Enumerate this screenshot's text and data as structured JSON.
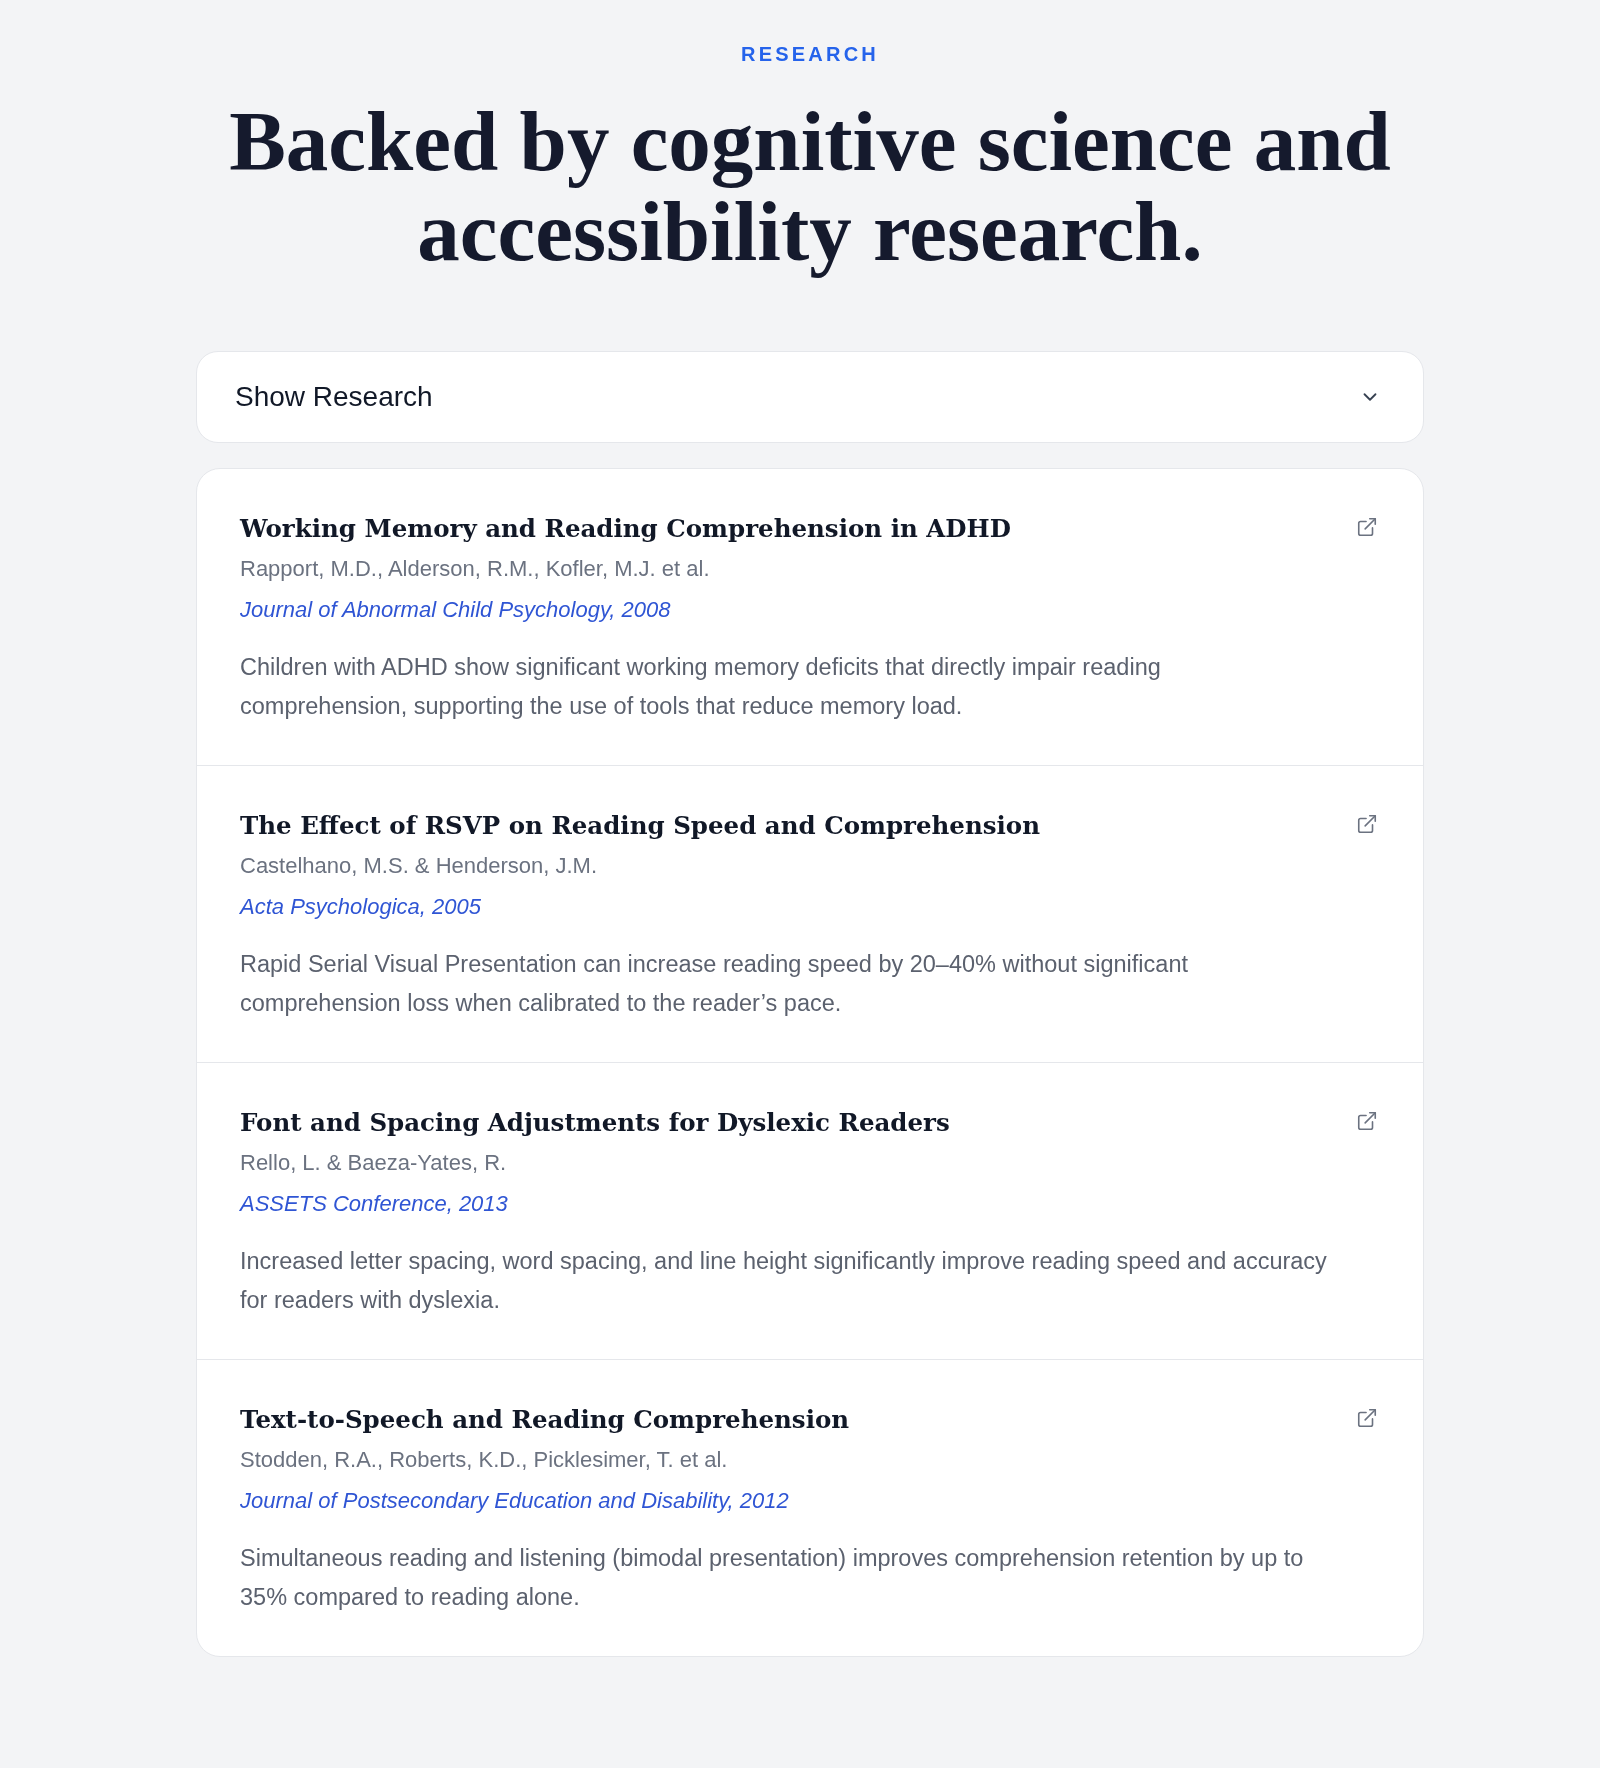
{
  "eyebrow": "RESEARCH",
  "headline": "Backed by cognitive science and accessibility research.",
  "toggle": {
    "label": "Show Research"
  },
  "studies": [
    {
      "title": "Working Memory and Reading Comprehension in ADHD",
      "authors": "Rapport, M.D., Alderson, R.M., Kofler, M.J. et al.",
      "source": "Journal of Abnormal Child Psychology, 2008",
      "summary": "Children with ADHD show significant working memory deficits that directly impair reading comprehension, supporting the use of tools that reduce memory load."
    },
    {
      "title": "The Effect of RSVP on Reading Speed and Comprehension",
      "authors": "Castelhano, M.S. & Henderson, J.M.",
      "source": "Acta Psychologica, 2005",
      "summary": "Rapid Serial Visual Presentation can increase reading speed by 20–40% without significant comprehension loss when calibrated to the reader’s pace."
    },
    {
      "title": "Font and Spacing Adjustments for Dyslexic Readers",
      "authors": "Rello, L. & Baeza-Yates, R.",
      "source": "ASSETS Conference, 2013",
      "summary": "Increased letter spacing, word spacing, and line height significantly improve reading speed and accuracy for readers with dyslexia."
    },
    {
      "title": "Text-to-Speech and Reading Comprehension",
      "authors": "Stodden, R.A., Roberts, K.D., Picklesimer, T. et al.",
      "source": "Journal of Postsecondary Education and Disability, 2012",
      "summary": "Simultaneous reading and listening (bimodal presentation) improves comprehension retention by up to 35% compared to reading alone."
    }
  ]
}
